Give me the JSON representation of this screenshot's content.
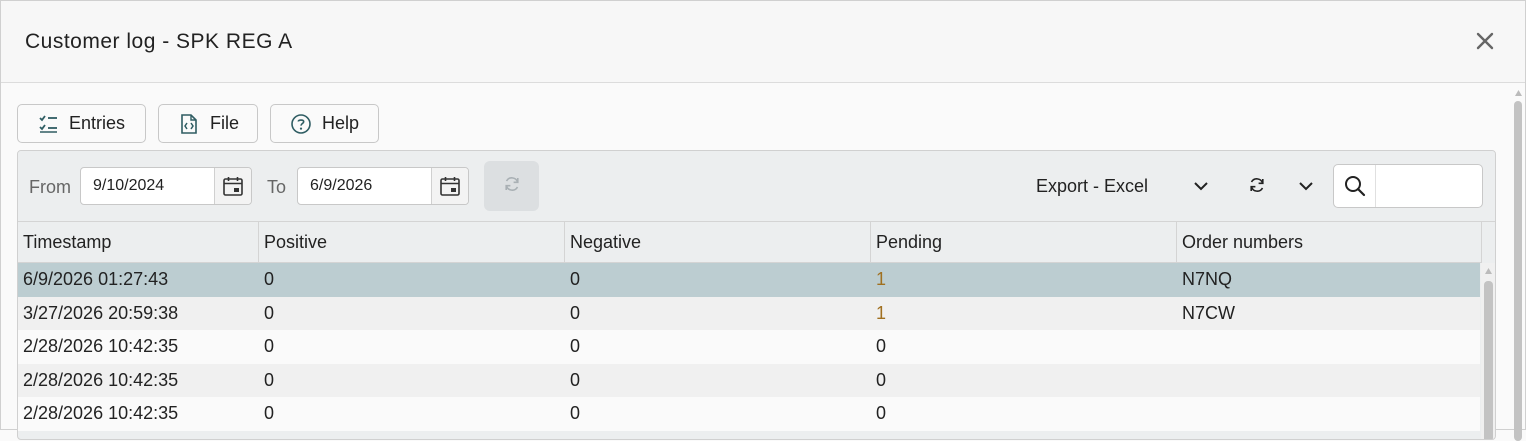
{
  "dialog": {
    "title": "Customer log - SPK REG A"
  },
  "toolbar": {
    "entries_label": "Entries",
    "file_label": "File",
    "help_label": "Help"
  },
  "filter": {
    "from_label": "From",
    "from_value": "9/10/2024",
    "to_label": "To",
    "to_value": "6/9/2026",
    "export_label": "Export - Excel",
    "search_value": ""
  },
  "table": {
    "columns": [
      "Timestamp",
      "Positive",
      "Negative",
      "Pending",
      "Order numbers"
    ],
    "rows": [
      [
        "6/9/2026 01:27:43",
        "0",
        "0",
        "1",
        "N7NQ"
      ],
      [
        "3/27/2026 20:59:38",
        "0",
        "0",
        "1",
        "N7CW"
      ],
      [
        "2/28/2026 10:42:35",
        "0",
        "0",
        "0",
        ""
      ],
      [
        "2/28/2026 10:42:35",
        "0",
        "0",
        "0",
        ""
      ],
      [
        "2/28/2026 10:42:35",
        "0",
        "0",
        "0",
        ""
      ]
    ]
  },
  "colors": {
    "selected_row": "#bccdd1",
    "pending_highlight": "#a07020",
    "accent_icon": "#2f5d63"
  }
}
